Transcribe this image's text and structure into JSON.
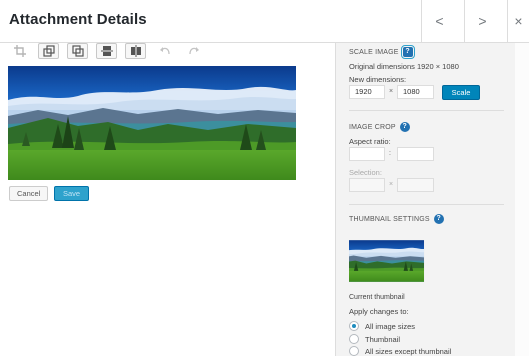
{
  "header": {
    "title": "Attachment Details",
    "prev_icon": "chevron-left-icon",
    "next_icon": "chevron-right-icon",
    "close_icon": "close-icon",
    "prev_glyph": "<",
    "next_glyph": ">",
    "close_glyph": "×"
  },
  "toolbar": {
    "tools": [
      "crop-icon",
      "rotate-left-icon",
      "rotate-right-icon",
      "flip-vertical-icon",
      "flip-horizontal-icon",
      "undo-icon",
      "redo-icon"
    ]
  },
  "editor": {
    "cancel_label": "Cancel",
    "save_label": "Save"
  },
  "scale": {
    "heading": "SCALE IMAGE",
    "help_glyph": "?",
    "original_label": "Original dimensions 1920 × 1080",
    "new_label": "New dimensions:",
    "width_value": "1920",
    "height_value": "1080",
    "times_glyph": "×",
    "scale_button": "Scale"
  },
  "crop": {
    "heading": "IMAGE CROP",
    "help_glyph": "?",
    "aspect_label": "Aspect ratio:",
    "ratio_sep": ":",
    "selection_label": "Selection:",
    "selection_sep": "×"
  },
  "thumbnail": {
    "heading": "THUMBNAIL SETTINGS",
    "help_glyph": "?",
    "caption": "Current thumbnail",
    "apply_label": "Apply changes to:",
    "options": [
      {
        "label": "All image sizes",
        "checked": true
      },
      {
        "label": "Thumbnail",
        "checked": false
      },
      {
        "label": "All sizes except thumbnail",
        "checked": false
      }
    ]
  },
  "colors": {
    "accent": "#0085ba",
    "help": "#2271b1"
  }
}
